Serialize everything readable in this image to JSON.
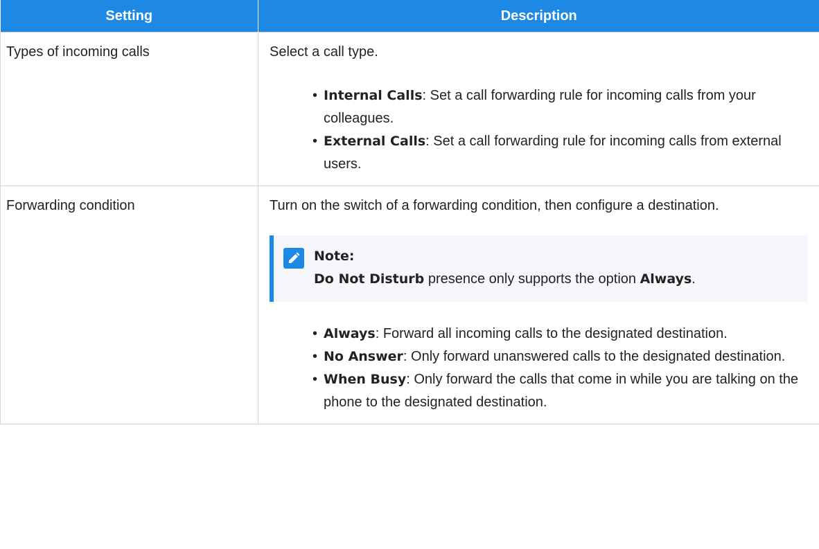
{
  "table": {
    "headers": [
      "Setting",
      "Description"
    ],
    "rows": [
      {
        "setting": "Types of incoming calls",
        "intro": "Select a call type.",
        "options": [
          {
            "term": "Internal Calls",
            "text": ": Set a call forwarding rule for incoming calls from your colleagues."
          },
          {
            "term": "External Calls",
            "text": ": Set a call forwarding rule for incoming calls from external users."
          }
        ]
      },
      {
        "setting": "Forwarding condition",
        "intro": "Turn on the switch of a forwarding condition, then configure a destination.",
        "note": {
          "title": "Note:",
          "term1": "Do Not Disturb",
          "text": " presence only supports the option ",
          "term2": "Always",
          "end": "."
        },
        "options": [
          {
            "term": "Always",
            "text": ": Forward all incoming calls to the designated destination."
          },
          {
            "term": "No Answer",
            "text": ": Only forward unanswered calls to the designated destination."
          },
          {
            "term": "When Busy",
            "text": ": Only forward the calls that come in while you are talking on the phone to the designated destination."
          }
        ]
      }
    ]
  },
  "colors": {
    "accent": "#1e88e5",
    "note_bg": "#f5f7fa",
    "border": "#d6d6d6"
  },
  "icons": {
    "note": "pencil-icon",
    "bullet": "•"
  }
}
